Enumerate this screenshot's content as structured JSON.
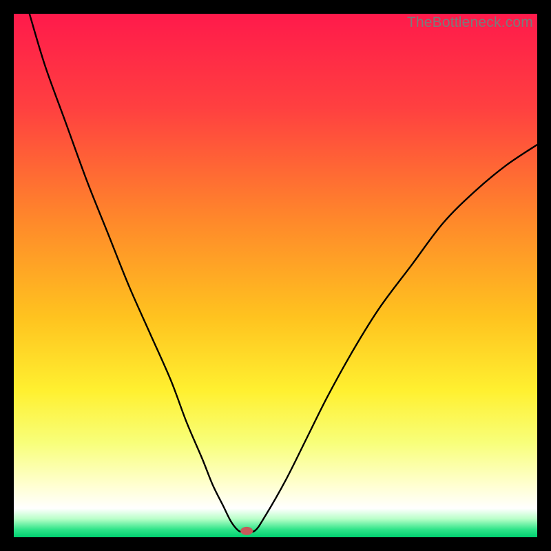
{
  "watermark": "TheBottleneck.com",
  "chart_data": {
    "type": "line",
    "title": "",
    "xlabel": "",
    "ylabel": "",
    "xlim": [
      0,
      100
    ],
    "ylim": [
      0,
      100
    ],
    "grid": false,
    "legend": false,
    "background_gradient": {
      "stops": [
        {
          "offset": 0.0,
          "color": "#ff1a4b"
        },
        {
          "offset": 0.18,
          "color": "#ff4040"
        },
        {
          "offset": 0.4,
          "color": "#ff8a2a"
        },
        {
          "offset": 0.58,
          "color": "#ffc31f"
        },
        {
          "offset": 0.72,
          "color": "#fff030"
        },
        {
          "offset": 0.82,
          "color": "#f8ff7a"
        },
        {
          "offset": 0.9,
          "color": "#ffffd0"
        },
        {
          "offset": 0.945,
          "color": "#ffffff"
        },
        {
          "offset": 0.965,
          "color": "#b8ffc8"
        },
        {
          "offset": 0.985,
          "color": "#30e58a"
        },
        {
          "offset": 1.0,
          "color": "#00d070"
        }
      ]
    },
    "series": [
      {
        "name": "bottleneck-curve",
        "x": [
          3,
          6,
          10,
          14,
          18,
          22,
          26,
          30,
          33,
          36,
          38,
          40,
          41.5,
          43,
          44,
          46,
          48,
          52,
          56,
          60,
          65,
          70,
          76,
          82,
          88,
          94,
          100
        ],
        "y": [
          100,
          90,
          79,
          68,
          58,
          48,
          39,
          30,
          22,
          15,
          10,
          6,
          3,
          1.2,
          1.2,
          1.2,
          4,
          11,
          19,
          27,
          36,
          44,
          52,
          60,
          66,
          71,
          75
        ]
      }
    ],
    "marker": {
      "name": "optimal-point",
      "x": 44.5,
      "y": 1.2,
      "color": "#c65a5a",
      "rx": 9,
      "ry": 6
    }
  }
}
